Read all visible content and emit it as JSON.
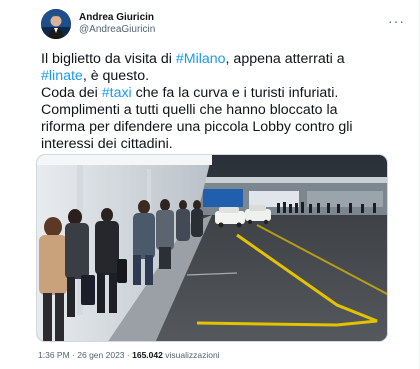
{
  "tweet": {
    "author": {
      "name": "Andrea Giuricin",
      "handle": "@AndreaGiuricin"
    },
    "text": {
      "line1_pre": "Il biglietto da visita di ",
      "hashtag_milano": "#Milano",
      "line1_post": ", appena atterrati a",
      "hashtag_linate": "#linate",
      "line2_post": ", è questo.",
      "line3_pre": "Coda dei ",
      "hashtag_taxi": "#taxi",
      "line3_post": " che fa la curva e i turisti infuriati.",
      "line4": "Complimenti a tutti quelli che hanno bloccato la",
      "line5": "riforma per difendere una piccola Lobby contro gli",
      "line6": "interessi dei cittadini."
    },
    "meta": {
      "time": "1:36 PM",
      "separator1": "·",
      "date": "26 gen 2023",
      "separator2": "·",
      "views_count": "165.042",
      "views_label": "visualizzazioni"
    }
  },
  "colors": {
    "link": "#1d9bf0",
    "text": "#0f1419",
    "secondary": "#536471"
  },
  "icons": {
    "more": "more-dots-icon"
  }
}
